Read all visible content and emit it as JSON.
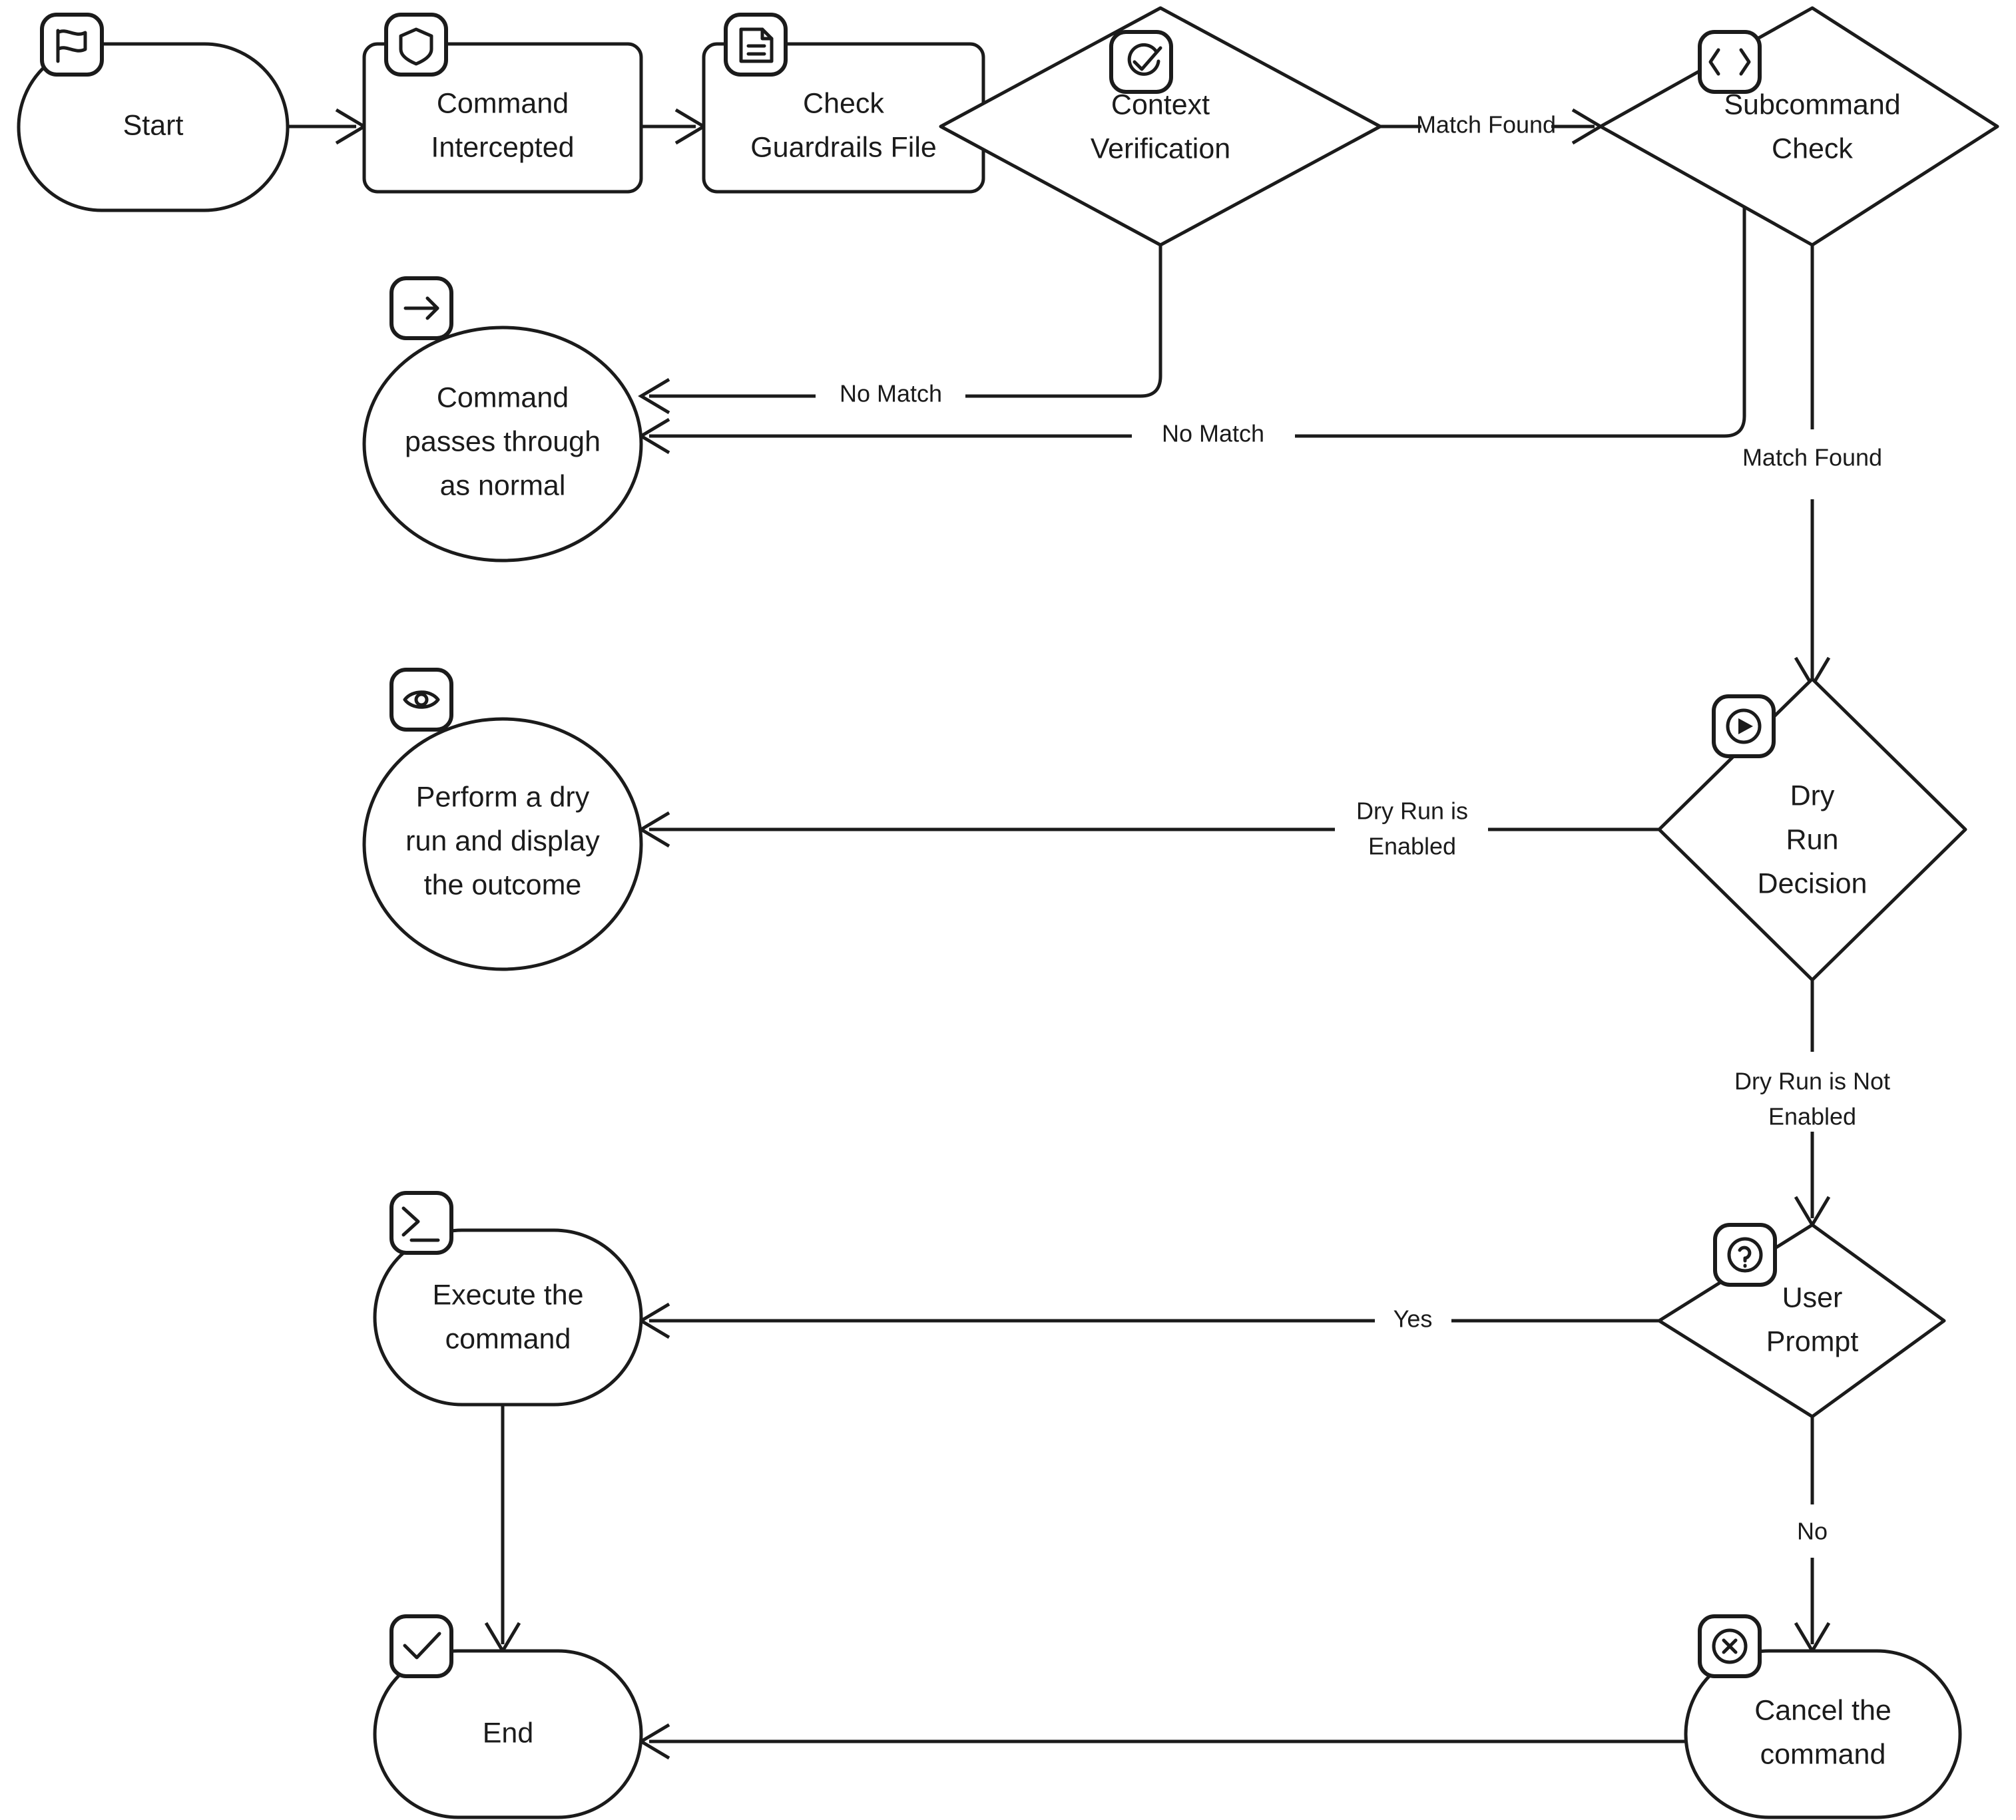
{
  "diagram": {
    "title": "Command Guardrails Flow",
    "background_color": "#ffffff",
    "stroke_color": "#1b1b1b",
    "nodes": [
      {
        "id": "start",
        "label_lines": [
          "Start"
        ],
        "shape": "stadium",
        "icon": "flag-icon"
      },
      {
        "id": "intercepted",
        "label_lines": [
          "Command",
          "Intercepted"
        ],
        "shape": "rect",
        "icon": "shield-icon"
      },
      {
        "id": "guardrails",
        "label_lines": [
          "Check",
          "Guardrails File"
        ],
        "shape": "rect",
        "icon": "document-icon"
      },
      {
        "id": "context",
        "label_lines": [
          "Context",
          "Verification"
        ],
        "shape": "diamond",
        "icon": "check-circle-icon"
      },
      {
        "id": "subcommand",
        "label_lines": [
          "Subcommand",
          "Check"
        ],
        "shape": "diamond",
        "icon": "code-brackets-icon"
      },
      {
        "id": "passthrough",
        "label_lines": [
          "Command",
          "passes through",
          "as normal"
        ],
        "shape": "circle",
        "icon": "arrow-right-icon"
      },
      {
        "id": "dryrunact",
        "label_lines": [
          "Perform a dry",
          "run and display",
          "the outcome"
        ],
        "shape": "circle",
        "icon": "eye-icon"
      },
      {
        "id": "dryrundec",
        "label_lines": [
          "Dry",
          "Run",
          "Decision"
        ],
        "shape": "diamond",
        "icon": "play-circle-icon"
      },
      {
        "id": "userprompt",
        "label_lines": [
          "User",
          "Prompt"
        ],
        "shape": "diamond",
        "icon": "question-circle-icon"
      },
      {
        "id": "execute",
        "label_lines": [
          "Execute the",
          "command"
        ],
        "shape": "stadium",
        "icon": "terminal-icon"
      },
      {
        "id": "cancel",
        "label_lines": [
          "Cancel the",
          "command"
        ],
        "shape": "stadium",
        "icon": "x-circle-icon"
      },
      {
        "id": "end",
        "label_lines": [
          "End"
        ],
        "shape": "stadium",
        "icon": "check-icon"
      }
    ],
    "edges": [
      {
        "id": "e1",
        "from": "start",
        "to": "intercepted",
        "label": ""
      },
      {
        "id": "e2",
        "from": "intercepted",
        "to": "guardrails",
        "label": ""
      },
      {
        "id": "e3",
        "from": "guardrails",
        "to": "context",
        "label": ""
      },
      {
        "id": "e4",
        "from": "context",
        "to": "subcommand",
        "label": "Match Found"
      },
      {
        "id": "e5",
        "from": "context",
        "to": "passthrough",
        "label": "No Match"
      },
      {
        "id": "e6",
        "from": "subcommand",
        "to": "passthrough",
        "label": "No Match"
      },
      {
        "id": "e7",
        "from": "subcommand",
        "to": "dryrundec",
        "label": "Match Found"
      },
      {
        "id": "e8",
        "from": "dryrundec",
        "to": "dryrunact",
        "label": "Dry Run is\nEnabled",
        "label_lines": [
          "Dry Run is",
          "Enabled"
        ]
      },
      {
        "id": "e9",
        "from": "dryrundec",
        "to": "userprompt",
        "label": "Dry Run is Not\nEnabled",
        "label_lines": [
          "Dry Run is Not",
          "Enabled"
        ]
      },
      {
        "id": "e10",
        "from": "userprompt",
        "to": "execute",
        "label": "Yes"
      },
      {
        "id": "e11",
        "from": "userprompt",
        "to": "cancel",
        "label": "No"
      },
      {
        "id": "e12",
        "from": "execute",
        "to": "end",
        "label": ""
      },
      {
        "id": "e13",
        "from": "cancel",
        "to": "end",
        "label": ""
      }
    ],
    "labels": {
      "start": "Start",
      "intercepted_l1": "Command",
      "intercepted_l2": "Intercepted",
      "guardrails_l1": "Check",
      "guardrails_l2": "Guardrails File",
      "context_l1": "Context",
      "context_l2": "Verification",
      "subcommand_l1": "Subcommand",
      "subcommand_l2": "Check",
      "passthrough_l1": "Command",
      "passthrough_l2": "passes through",
      "passthrough_l3": "as normal",
      "dryrunact_l1": "Perform a dry",
      "dryrunact_l2": "run and display",
      "dryrunact_l3": "the outcome",
      "dryrundec_l1": "Dry",
      "dryrundec_l2": "Run",
      "dryrundec_l3": "Decision",
      "userprompt_l1": "User",
      "userprompt_l2": "Prompt",
      "execute_l1": "Execute the",
      "execute_l2": "command",
      "cancel_l1": "Cancel the",
      "cancel_l2": "command",
      "end": "End",
      "edge_match_found_1": "Match Found",
      "edge_no_match_1": "No Match",
      "edge_no_match_2": "No Match",
      "edge_match_found_2": "Match Found",
      "edge_dryrun_enabled_l1": "Dry Run is",
      "edge_dryrun_enabled_l2": "Enabled",
      "edge_dryrun_not_enabled_l1": "Dry Run is Not",
      "edge_dryrun_not_enabled_l2": "Enabled",
      "edge_yes": "Yes",
      "edge_no": "No"
    }
  }
}
